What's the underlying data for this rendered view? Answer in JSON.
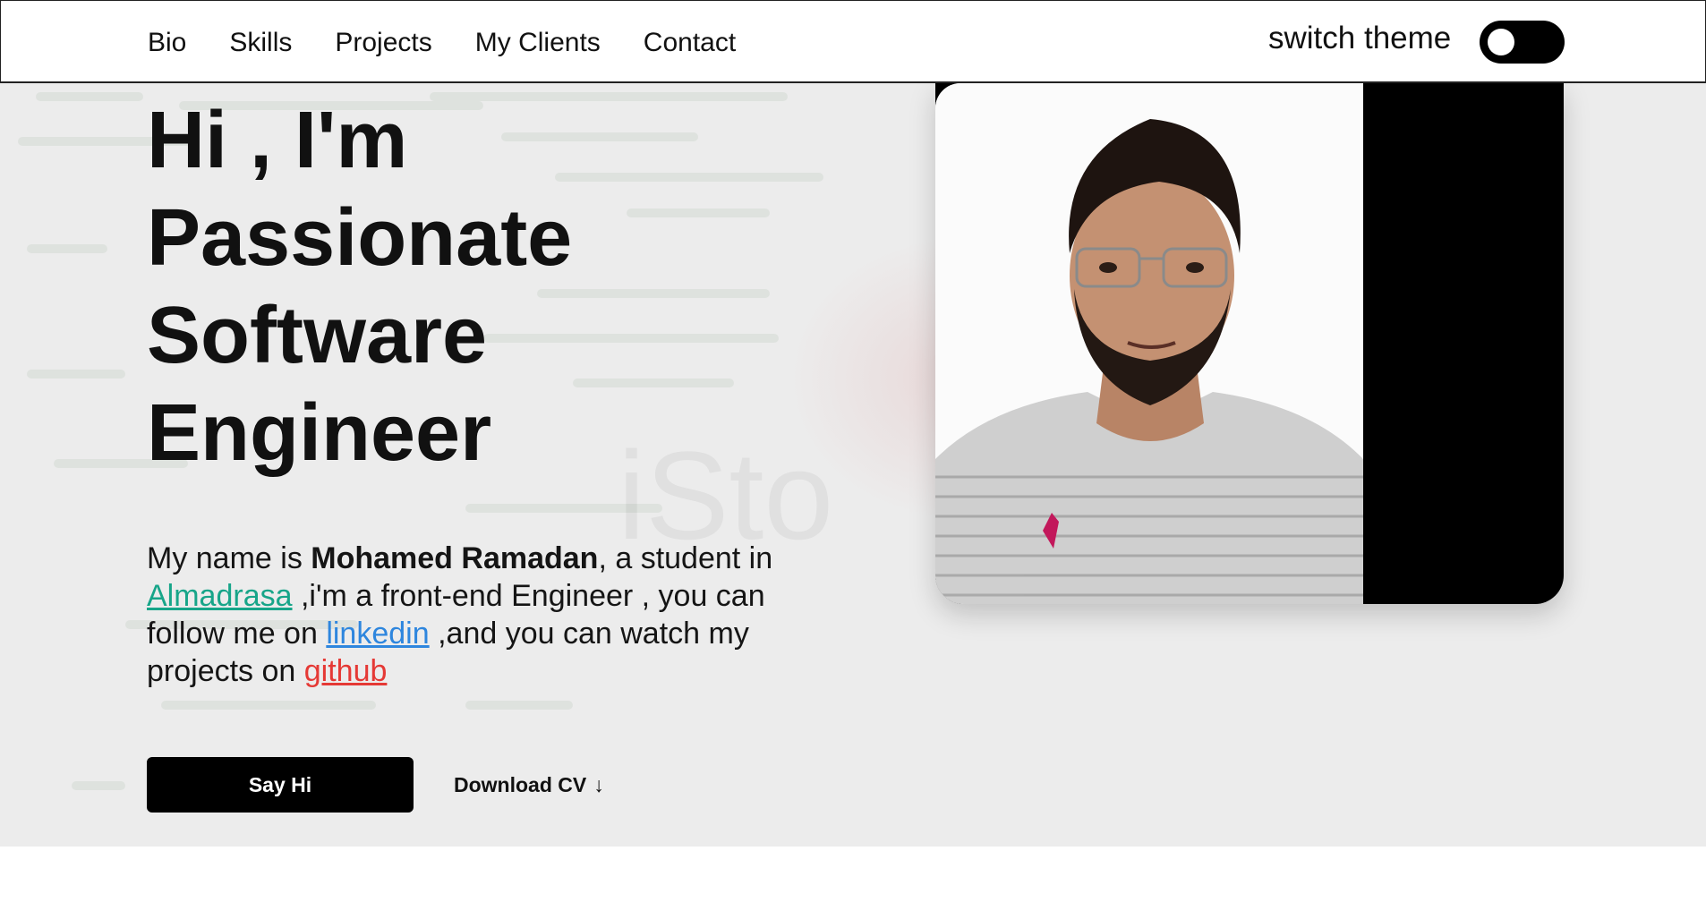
{
  "nav": {
    "items": [
      "Bio",
      "Skills",
      "Projects",
      "My Clients",
      "Contact"
    ],
    "theme_label": "switch theme"
  },
  "hero": {
    "headline": [
      "Hi , I'm",
      "Passionate",
      "Software",
      "Engineer"
    ],
    "intro": {
      "t1": "My name is ",
      "name": "Mohamed Ramadan",
      "t2": ", a student in ",
      "almadrasa": "Almadrasa",
      "t3": " ,i'm a front-end Engineer , you can follow me on ",
      "linkedin": "linkedin",
      "t4": " ,and you can watch my projects on ",
      "github": "github"
    },
    "say_hi_label": "Say Hi",
    "download_label": "Download CV",
    "download_arrow": "↓",
    "watermark": "iSto"
  },
  "colors": {
    "almadrasa_link": "#17a589",
    "linkedin_link": "#2e86de",
    "github_link": "#e53935",
    "button_bg": "#000000"
  },
  "icons": {
    "theme_toggle": "toggle-switch-icon",
    "download_arrow": "arrow-down-icon"
  }
}
